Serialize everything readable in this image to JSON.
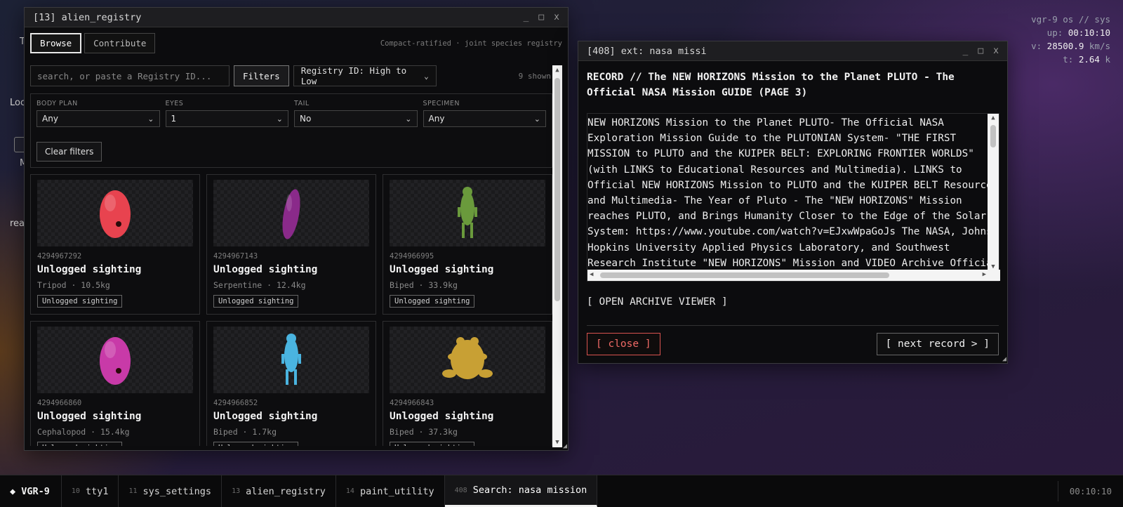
{
  "desktop": {
    "peek_labels": [
      "T",
      "Loc",
      "M",
      "rea"
    ]
  },
  "sysinfo": {
    "line1": "vgr-9 os // sys",
    "up_label": "up:",
    "up_value": "00:10:10",
    "v_label": "v:",
    "v_value": "28500.9",
    "v_unit": "km/s",
    "t_label": "t:",
    "t_value": "2.64",
    "t_unit": "k"
  },
  "registry_window": {
    "title": "[13] alien_registry",
    "tabs": [
      "Browse",
      "Contribute"
    ],
    "tagline": "Compact-ratified · joint species registry",
    "search_placeholder": "search, or paste a Registry ID...",
    "filters_label": "Filters",
    "sort_value": "Registry ID: High to Low",
    "shown_count": "9 shown",
    "filters": [
      {
        "label": "BODY PLAN",
        "value": "Any"
      },
      {
        "label": "EYES",
        "value": "1"
      },
      {
        "label": "TAIL",
        "value": "No"
      },
      {
        "label": "SPECIMEN",
        "value": "Any"
      }
    ],
    "clear_label": "Clear filters",
    "cards": [
      {
        "id": "4294967292",
        "name": "Unlogged sighting",
        "meta": "Tripod · 10.5kg",
        "badge": "Unlogged sighting",
        "color": "#e8434f",
        "shape": "blob"
      },
      {
        "id": "4294967143",
        "name": "Unlogged sighting",
        "meta": "Serpentine · 12.4kg",
        "badge": "Unlogged sighting",
        "color": "#8a2a8a",
        "shape": "slug"
      },
      {
        "id": "4294966995",
        "name": "Unlogged sighting",
        "meta": "Biped · 33.9kg",
        "badge": "Unlogged sighting",
        "color": "#6a9a3c",
        "shape": "biped"
      },
      {
        "id": "4294966860",
        "name": "Unlogged sighting",
        "meta": "Cephalopod · 15.4kg",
        "badge": "Unlogged sighting",
        "color": "#c83aa8",
        "shape": "blob"
      },
      {
        "id": "4294966852",
        "name": "Unlogged sighting",
        "meta": "Biped · 1.7kg",
        "badge": "Unlogged sighting",
        "color": "#4ab4e0",
        "shape": "biped"
      },
      {
        "id": "4294966843",
        "name": "Unlogged sighting",
        "meta": "Biped · 37.3kg",
        "badge": "Unlogged sighting",
        "color": "#c8a034",
        "shape": "frog"
      }
    ]
  },
  "record_window": {
    "title": "[408] ext: nasa missi",
    "heading": "RECORD // The NEW HORIZONS Mission to the Planet PLUTO - The Official NASA Mission GUIDE (PAGE 3)",
    "body_lines": [
      "NEW HORIZONS Mission to the Planet PLUTO- The Official NASA",
      "Exploration Mission Guide to the PLUTONIAN System- \"THE FIRST",
      "MISSION to PLUTO and the KUIPER BELT: EXPLORING FRONTIER WORLDS\"",
      "(with LINKS to Educational Resources and Multimedia). LINKS to",
      "Official NEW HORIZONS Mission to PLUTO and the KUIPER BELT Resources",
      "and Multimedia- The Year of Pluto - The \"NEW HORIZONS\" Mission",
      "reaches PLUTO, and Brings Humanity Closer to the Edge of the Solar",
      "System: https://www.youtube.com/watch?v=EJxwWpaGoJs The NASA, Johns",
      "Hopkins University Applied Physics Laboratory, and Southwest",
      "Research Institute \"NEW HORIZONS\" Mission and VIDEO Archive Official"
    ],
    "archive_link": "[ OPEN ARCHIVE VIEWER ]",
    "close_label": "[ close ]",
    "next_label": "[ next record > ]"
  },
  "taskbar": {
    "brand": "◆ VGR-9",
    "items": [
      {
        "num": "10",
        "label": "tty1",
        "active": false
      },
      {
        "num": "11",
        "label": "sys_settings",
        "active": false
      },
      {
        "num": "13",
        "label": "alien_registry",
        "active": false
      },
      {
        "num": "14",
        "label": "paint_utility",
        "active": false
      },
      {
        "num": "408",
        "label": "Search: nasa mission",
        "active": true
      }
    ],
    "clock": "00:10:10"
  },
  "colors": {
    "accent_close": "#d9534f",
    "window_bg": "#0c0c0e"
  }
}
